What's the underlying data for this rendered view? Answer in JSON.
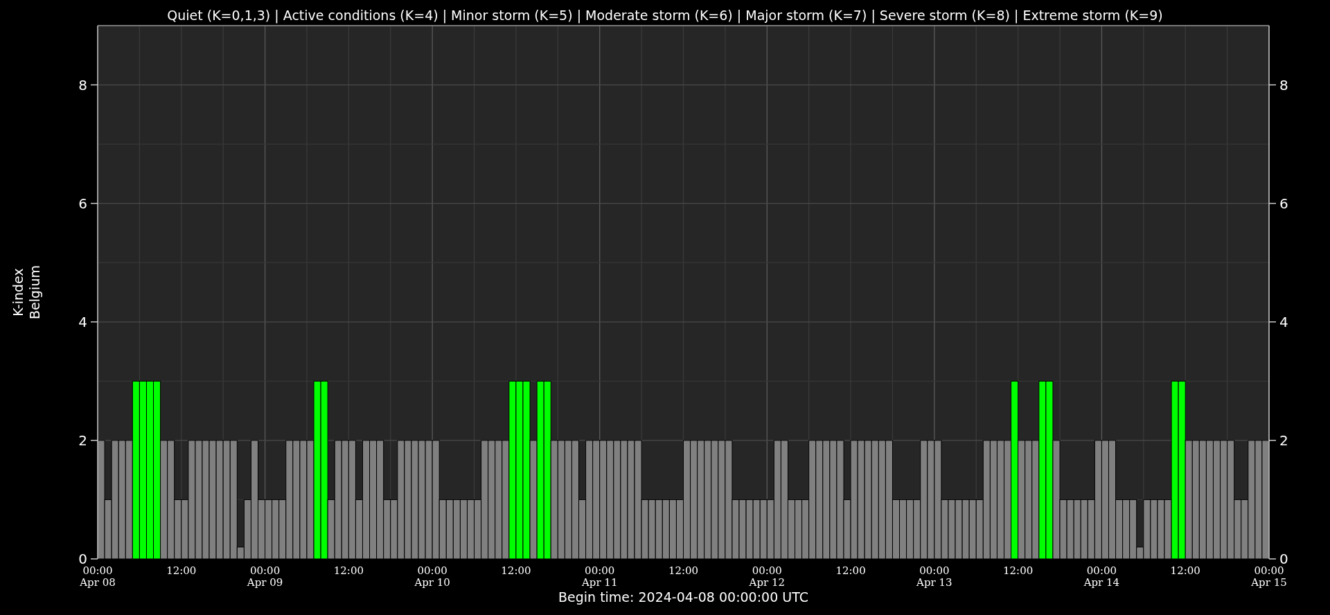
{
  "title": "Quiet (K=0,1,3) | Active conditions (K=4) | Minor storm (K=5) | Moderate storm (K=6) | Major storm (K=7) | Severe storm (K=8) | Extreme storm (K=9)",
  "chart_data": {
    "type": "bar",
    "xlabel": "Begin time: 2024-04-08 00:00:00 UTC",
    "ylabel": "K-index\nBelgium",
    "categories": [
      "00:00\nApr 08",
      null,
      null,
      null,
      null,
      null,
      null,
      null,
      null,
      null,
      null,
      null,
      "12:00",
      null,
      null,
      null,
      null,
      null,
      null,
      null,
      null,
      null,
      null,
      null,
      "00:00\nApr 09",
      null,
      null,
      null,
      null,
      null,
      null,
      null,
      null,
      null,
      null,
      null,
      "12:00",
      null,
      null,
      null,
      null,
      null,
      null,
      null,
      null,
      null,
      null,
      null,
      "00:00\nApr 10",
      null,
      null,
      null,
      null,
      null,
      null,
      null,
      null,
      null,
      null,
      null,
      "12:00",
      null,
      null,
      null,
      null,
      null,
      null,
      null,
      null,
      null,
      null,
      null,
      "00:00\nApr 11",
      null,
      null,
      null,
      null,
      null,
      null,
      null,
      null,
      null,
      null,
      null,
      "12:00",
      null,
      null,
      null,
      null,
      null,
      null,
      null,
      null,
      null,
      null,
      null,
      "00:00\nApr 12",
      null,
      null,
      null,
      null,
      null,
      null,
      null,
      null,
      null,
      null,
      null,
      "12:00",
      null,
      null,
      null,
      null,
      null,
      null,
      null,
      null,
      null,
      null,
      null,
      "00:00\nApr 13",
      null,
      null,
      null,
      null,
      null,
      null,
      null,
      null,
      null,
      null,
      null,
      "12:00",
      null,
      null,
      null,
      null,
      null,
      null,
      null,
      null,
      null,
      null,
      null,
      "00:00\nApr 14",
      null,
      null,
      null,
      null,
      null,
      null,
      null,
      null,
      null,
      null,
      null,
      "12:00",
      null,
      null,
      null,
      null,
      null,
      null,
      null,
      null,
      null,
      null,
      null,
      "00:00\nApr 15"
    ],
    "values": [
      2,
      1,
      2,
      2,
      2,
      3,
      3,
      3,
      3,
      2,
      2,
      1,
      1,
      2,
      2,
      2,
      2,
      2,
      2,
      2,
      0.2,
      1,
      2,
      1,
      1,
      1,
      1,
      2,
      2,
      2,
      2,
      3,
      3,
      1,
      2,
      2,
      2,
      1,
      2,
      2,
      2,
      1,
      1,
      2,
      2,
      2,
      2,
      2,
      2,
      1,
      1,
      1,
      1,
      1,
      1,
      2,
      2,
      2,
      2,
      3,
      3,
      3,
      2,
      3,
      3,
      2,
      2,
      2,
      2,
      1,
      2,
      2,
      2,
      2,
      2,
      2,
      2,
      2,
      1,
      1,
      1,
      1,
      1,
      1,
      2,
      2,
      2,
      2,
      2,
      2,
      2,
      1,
      1,
      1,
      1,
      1,
      1,
      2,
      2,
      1,
      1,
      1,
      2,
      2,
      2,
      2,
      2,
      1,
      2,
      2,
      2,
      2,
      2,
      2,
      1,
      1,
      1,
      1,
      2,
      2,
      2,
      1,
      1,
      1,
      1,
      1,
      1,
      2,
      2,
      2,
      2,
      3,
      2,
      2,
      2,
      3,
      3,
      2,
      1,
      1,
      1,
      1,
      1,
      2,
      2,
      2,
      1,
      1,
      1,
      0.2,
      1,
      1,
      1,
      1,
      3,
      3,
      2,
      2,
      2,
      2,
      2,
      2,
      2,
      1,
      1,
      2,
      2,
      2,
      null
    ],
    "ylim": [
      0,
      9
    ],
    "yticks": [
      0,
      2,
      4,
      6,
      8
    ],
    "y2ticks": [
      0,
      2,
      4,
      6,
      8
    ],
    "y2lim": [
      0,
      9
    ],
    "grid": true
  }
}
